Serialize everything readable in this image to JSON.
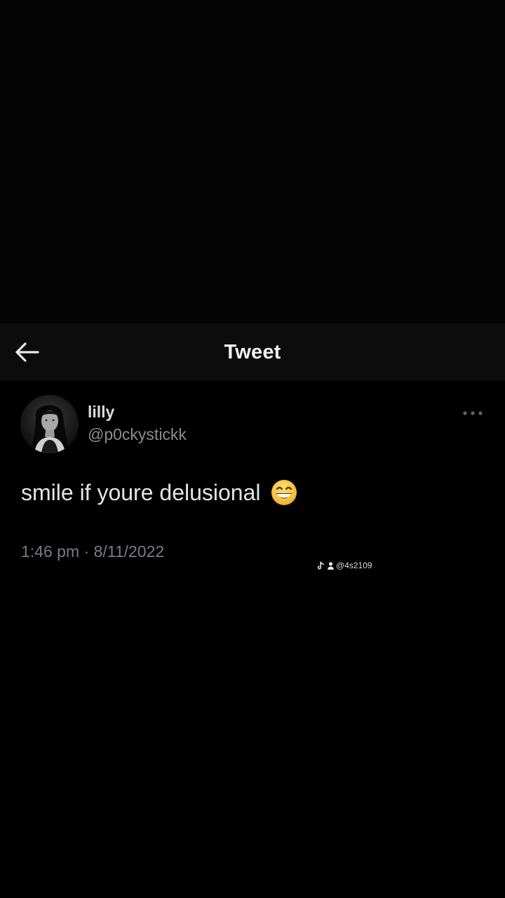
{
  "header": {
    "title": "Tweet",
    "back_icon": "arrow-left-icon"
  },
  "tweet": {
    "display_name": "lilly",
    "handle": "@p0ckystickk",
    "text": "smile if youre delusional",
    "emoji": "grinning-face-with-smiling-eyes-icon",
    "time": "1:46 pm",
    "separator": "·",
    "date": "8/11/2022",
    "more_icon": "more-horizontal-icon"
  },
  "watermark": {
    "platform_icon": "tiktok-icon",
    "user_icon": "person-icon",
    "text": "@4s2109"
  },
  "colors": {
    "background": "#000000",
    "header_background": "#0c0c0c",
    "primary_text": "#e4e4e4",
    "secondary_text": "#797c80"
  }
}
